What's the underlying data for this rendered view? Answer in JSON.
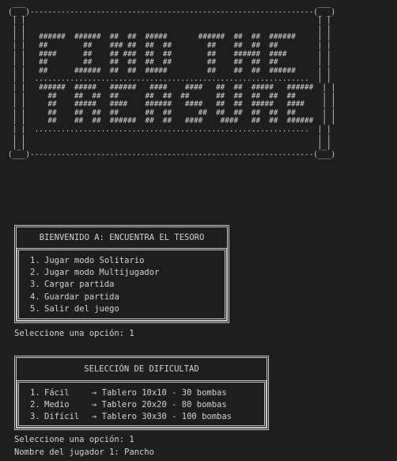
{
  "banner": {
    "lines": [
      " ___                                                                  ___",
      "(_ _)----------------------------------------------------------------(_ _)",
      " | |                                                                  | |",
      " | |                                                                  | |",
      " | |   ######  ######  ##  ##  #####       ######  ##  ##  ######     | |",
      " | |   ##        ##    ### ##  ##  ##        ##    ##  ##  ##         | |",
      " | |   ####      ##    ## ###  ##  ##        ##    ######  ####       | |",
      " | |   ##        ##    ##  ##  ##  ##        ##    ##  ##  ##         | |",
      " | |   ##      ######  ##  ##  #####         ##    ##  ##  ######     | |",
      " | |  ..............................................................  | |",
      " | |   ######  #####   ######   ####    ####   ##  ##  #####   ######  | |",
      " | |     ##    ##  ##  ##      ##  ##  ##      ##  ##  ##  ##  ##      | |",
      " | |     ##    #####   ####    ######   ####   ##  ##  #####   ####    | |",
      " | |     ##    ##  ##  ##      ##  ##      ##  ##  ##  ##  ##  ##      | |",
      " | |     ##    ##  ##  ######  ##  ##   ####    ####   ##  ##  ######  | |",
      " | |  ..............................................................  | |",
      " | |                                                                  | |",
      " |_|                                                                  |_|",
      "(___)----------------------------------------------------------------(___)"
    ]
  },
  "menu": {
    "title": "BIENVENIDO A: ENCUENTRA EL TESORO",
    "options": [
      {
        "num": "1.",
        "label": "Jugar modo Solitario"
      },
      {
        "num": "2.",
        "label": "Jugar modo Multijugador"
      },
      {
        "num": "3.",
        "label": "Cargar partida"
      },
      {
        "num": "4.",
        "label": "Guardar partida"
      },
      {
        "num": "5.",
        "label": "Salir del juego"
      }
    ],
    "prompt": "Seleccione una opción: 1"
  },
  "difficulty": {
    "title": "SELECCIÓN DE DIFICULTAD",
    "options": [
      {
        "num": "1.",
        "name": "Fácil",
        "desc": "→ Tablero 10x10 - 30 bombas"
      },
      {
        "num": "2.",
        "name": "Medio",
        "desc": "→ Tablero 20x20 - 80 bombas"
      },
      {
        "num": "3.",
        "name": "Difícil",
        "desc": "→ Tablero 30x30 - 100 bombas"
      }
    ],
    "prompt": "Seleccione una opción: 1",
    "player_prompt": "Nombre del jugador 1: Pancho"
  }
}
